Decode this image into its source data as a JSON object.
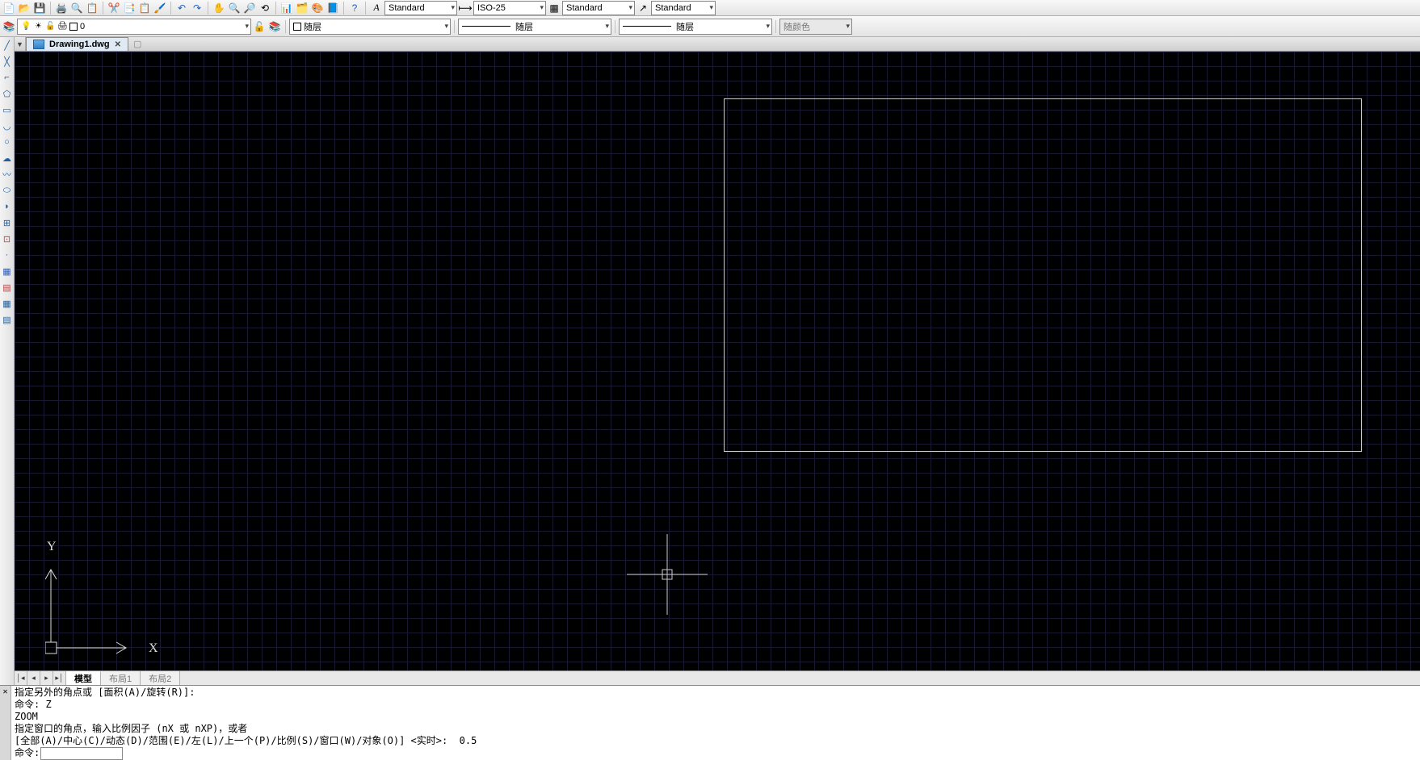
{
  "toolbar1": {
    "style_dd1": "Standard",
    "dim_dd": "ISO-25",
    "style_dd2": "Standard",
    "style_dd3": "Standard"
  },
  "toolbar2": {
    "layer_dd": "0",
    "linetype1": "随层",
    "lineweight": "随层",
    "linetype2": "随层",
    "color_dd": "随颜色"
  },
  "file_tab": {
    "name": "Drawing1.dwg"
  },
  "layout_tabs": {
    "model": "模型",
    "layout1": "布局1",
    "layout2": "布局2"
  },
  "cmd": {
    "line1": "指定另外的角点或 [面积(A)/旋转(R)]:",
    "line2": "命令: Z",
    "line3": "ZOOM",
    "line4": "指定窗口的角点，输入比例因子 (nX 或 nXP)，或者",
    "line5": "[全部(A)/中心(C)/动态(D)/范围(E)/左(L)/上一个(P)/比例(S)/窗口(W)/对象(O)] <实时>:  0.5",
    "prompt": "命令:"
  },
  "ucs": {
    "x": "X",
    "y": "Y"
  }
}
